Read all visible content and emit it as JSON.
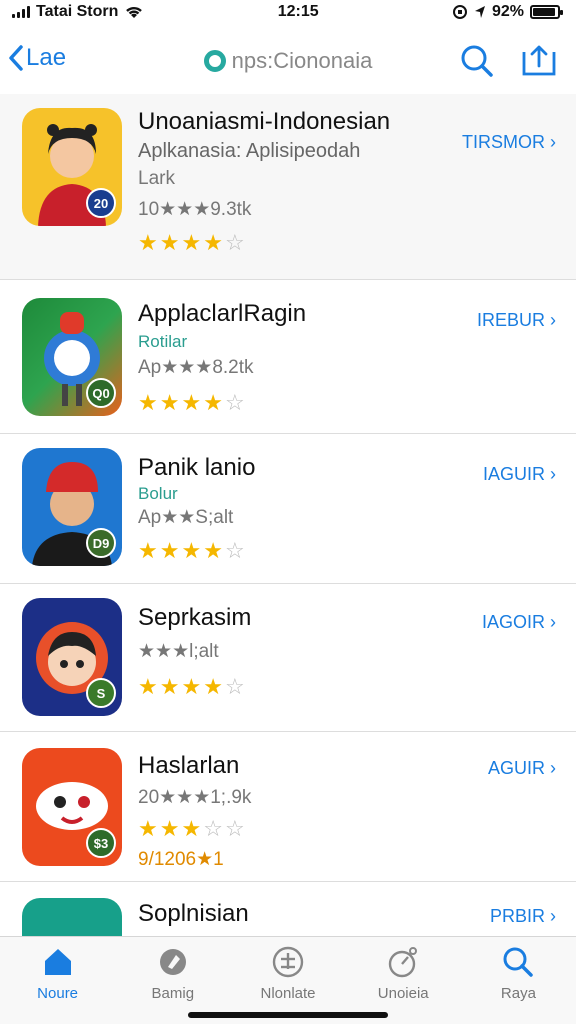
{
  "status": {
    "carrier": "Tatai Storn",
    "time": "12:15",
    "battery": "92%",
    "battery_level": 0.92
  },
  "nav": {
    "back_label": "Lae",
    "title": "nps:Ciononaia"
  },
  "apps": [
    {
      "name": "Unoaniasmi-Indonesian",
      "subtitle": "Aplkanasia: Aplisipeodah",
      "developer": "Lark",
      "rating_text": "10★★★9.3tk",
      "stars": 4,
      "action": "TIRSMOR ›",
      "badge": "20"
    },
    {
      "name": "ApplaclarlRagin",
      "subtitle": "Rotilar",
      "rating_text": "Ap★★★8.2tk",
      "stars": 4,
      "action": "IREBUR ›",
      "badge": "Q0"
    },
    {
      "name": "Panik lanio",
      "subtitle": "Bolur",
      "rating_text": "Ap★★S;alt",
      "stars": 4,
      "action": "IAGUIR ›",
      "badge": "D9"
    },
    {
      "name": "Seprkasim",
      "rating_text": "★★★l;alt",
      "stars": 4,
      "action": "IAGOIR ›",
      "badge": "S"
    },
    {
      "name": "Haslarlan",
      "rating_text": "20★★★1;.9k",
      "stars": 3,
      "extra": "9/1206★1",
      "action": "AGUIR ›",
      "badge": "$3"
    },
    {
      "name": "Soplnisian",
      "action": "PRBIR ›"
    }
  ],
  "tabs": [
    {
      "label": "Noure",
      "icon": "home-icon",
      "active": true
    },
    {
      "label": "Bamig",
      "icon": "games-icon",
      "active": false
    },
    {
      "label": "Nlonlate",
      "icon": "apps-icon",
      "active": false
    },
    {
      "label": "Unoieia",
      "icon": "updates-icon",
      "active": false
    },
    {
      "label": "Raya",
      "icon": "search-icon",
      "active": false
    }
  ]
}
